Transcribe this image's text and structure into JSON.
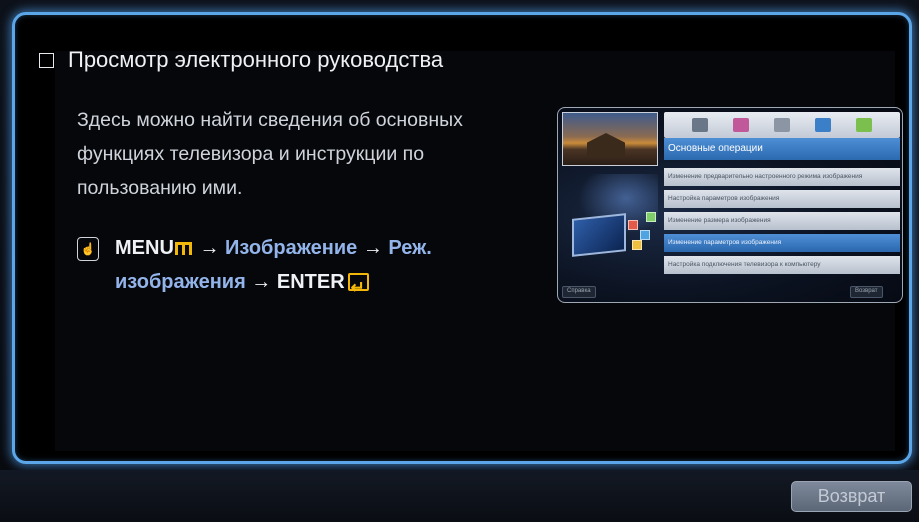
{
  "guide": {
    "heading": "Просмотр электронного руководства",
    "description": "Здесь можно найти сведения об основных функциях телевизора и инструкции по пользованию ими.",
    "menu_path": {
      "menu": "MENU",
      "arrow1": " → ",
      "picture": "Изображение",
      "arrow2": " → ",
      "mode_part1": "Реж.",
      "mode_part2": "изображения",
      "arrow3": " → ",
      "enter": "ENTER"
    }
  },
  "thumbnail": {
    "category_title": "Основные операции",
    "items": [
      "Изменение предварительно настроенного режима изображения",
      "Настройка параметров изображения",
      "Изменение размера изображения",
      "Изменение параметров изображения",
      "Настройка подключения телевизора к компьютеру"
    ],
    "left_button": "Справка",
    "right_button": "Возврат"
  },
  "footer": {
    "back_label": "Возврат"
  },
  "colors": {
    "panel_border": "#5aa6e8",
    "link": "#93b4ea",
    "remote_key": "#f2b708"
  }
}
